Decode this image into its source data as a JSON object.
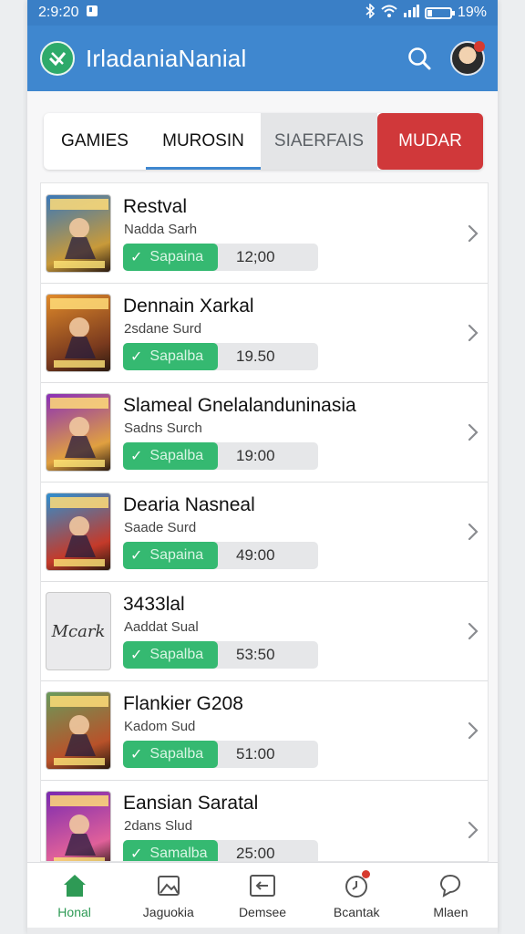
{
  "status_bar": {
    "time": "2:9:20",
    "battery": "19%"
  },
  "app_bar": {
    "title": "IrladaniaNanial"
  },
  "tabs": [
    {
      "label": "GAMIES"
    },
    {
      "label": "MUROSIN"
    },
    {
      "label": "SIAERFAIS"
    },
    {
      "label": "MUDAR"
    }
  ],
  "list": [
    {
      "title": "Restval",
      "subtitle": "Nadda Sarh",
      "badge": "Sapaina",
      "time": "12;00",
      "thumb": "art",
      "thumb_colors": [
        "#3a78b8",
        "#c89a3a"
      ]
    },
    {
      "title": "Dennain Xarkal",
      "subtitle": "2sdane Surd",
      "badge": "Sapalba",
      "time": "19.50",
      "thumb": "art",
      "thumb_colors": [
        "#e08a2a",
        "#7a3a1e"
      ]
    },
    {
      "title": "Slameal Gnelalanduninasia",
      "subtitle": "Sadns Surch",
      "badge": "Sapalba",
      "time": "19:00",
      "thumb": "art",
      "thumb_colors": [
        "#8a2fb8",
        "#e0a040"
      ]
    },
    {
      "title": "Dearia Nasneal",
      "subtitle": "Saade Surd",
      "badge": "Sapaina",
      "time": "49:00",
      "thumb": "art",
      "thumb_colors": [
        "#2e8fd0",
        "#c43a2a"
      ]
    },
    {
      "title": "3433lal",
      "subtitle": "Aaddat Sual",
      "badge": "Sapalba",
      "time": "53:50",
      "thumb": "placeholder",
      "thumb_text": "Mcark"
    },
    {
      "title": "Flankier G208",
      "subtitle": "Kadom Sud",
      "badge": "Sapalba",
      "time": "51:00",
      "thumb": "art",
      "thumb_colors": [
        "#6a9a5a",
        "#b8522a"
      ]
    },
    {
      "title": "Eansian Saratal",
      "subtitle": "2dans Slud",
      "badge": "Samalba",
      "time": "25:00",
      "thumb": "art",
      "thumb_colors": [
        "#7a2ab0",
        "#e0609a"
      ]
    }
  ],
  "bottom_nav": [
    {
      "label": "Honal",
      "icon": "home-icon",
      "active": true
    },
    {
      "label": "Jaguokia",
      "icon": "image-icon",
      "active": false
    },
    {
      "label": "Demsee",
      "icon": "back-box-icon",
      "active": false
    },
    {
      "label": "Bcantak",
      "icon": "clock-icon",
      "active": false
    },
    {
      "label": "Mlaen",
      "icon": "chat-icon",
      "active": false
    }
  ],
  "colors": {
    "accent": "#3f87cf",
    "success": "#35b971",
    "danger": "#d0383a",
    "nav_active": "#2e9a55"
  }
}
